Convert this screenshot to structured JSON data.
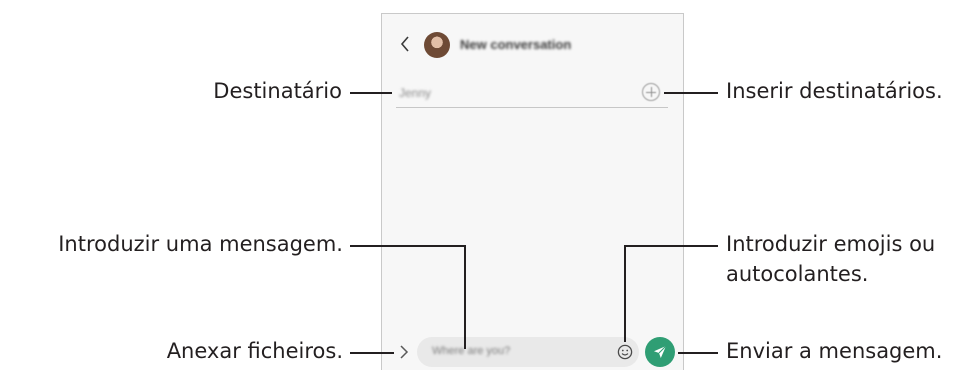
{
  "screen": {
    "header": {
      "title": "New conversation"
    },
    "recipient_field": {
      "value": "Jenny"
    },
    "composer": {
      "placeholder": "Where are you?"
    }
  },
  "callouts": {
    "recipient": "Destinatário",
    "add_recipients": "Inserir destinatários.",
    "enter_message": "Introduzir uma mensagem.",
    "emoji_stickers_line1": "Introduzir emojis ou",
    "emoji_stickers_line2": "autocolantes.",
    "attach_files": "Anexar ficheiros.",
    "send_message": "Enviar a mensagem."
  },
  "colors": {
    "send_button": "#2f9e74",
    "callout_text": "#231f20"
  },
  "icons": [
    "back-arrow-icon",
    "contact-avatar",
    "add-recipient-icon",
    "expand-icon",
    "emoji-icon",
    "send-icon"
  ]
}
